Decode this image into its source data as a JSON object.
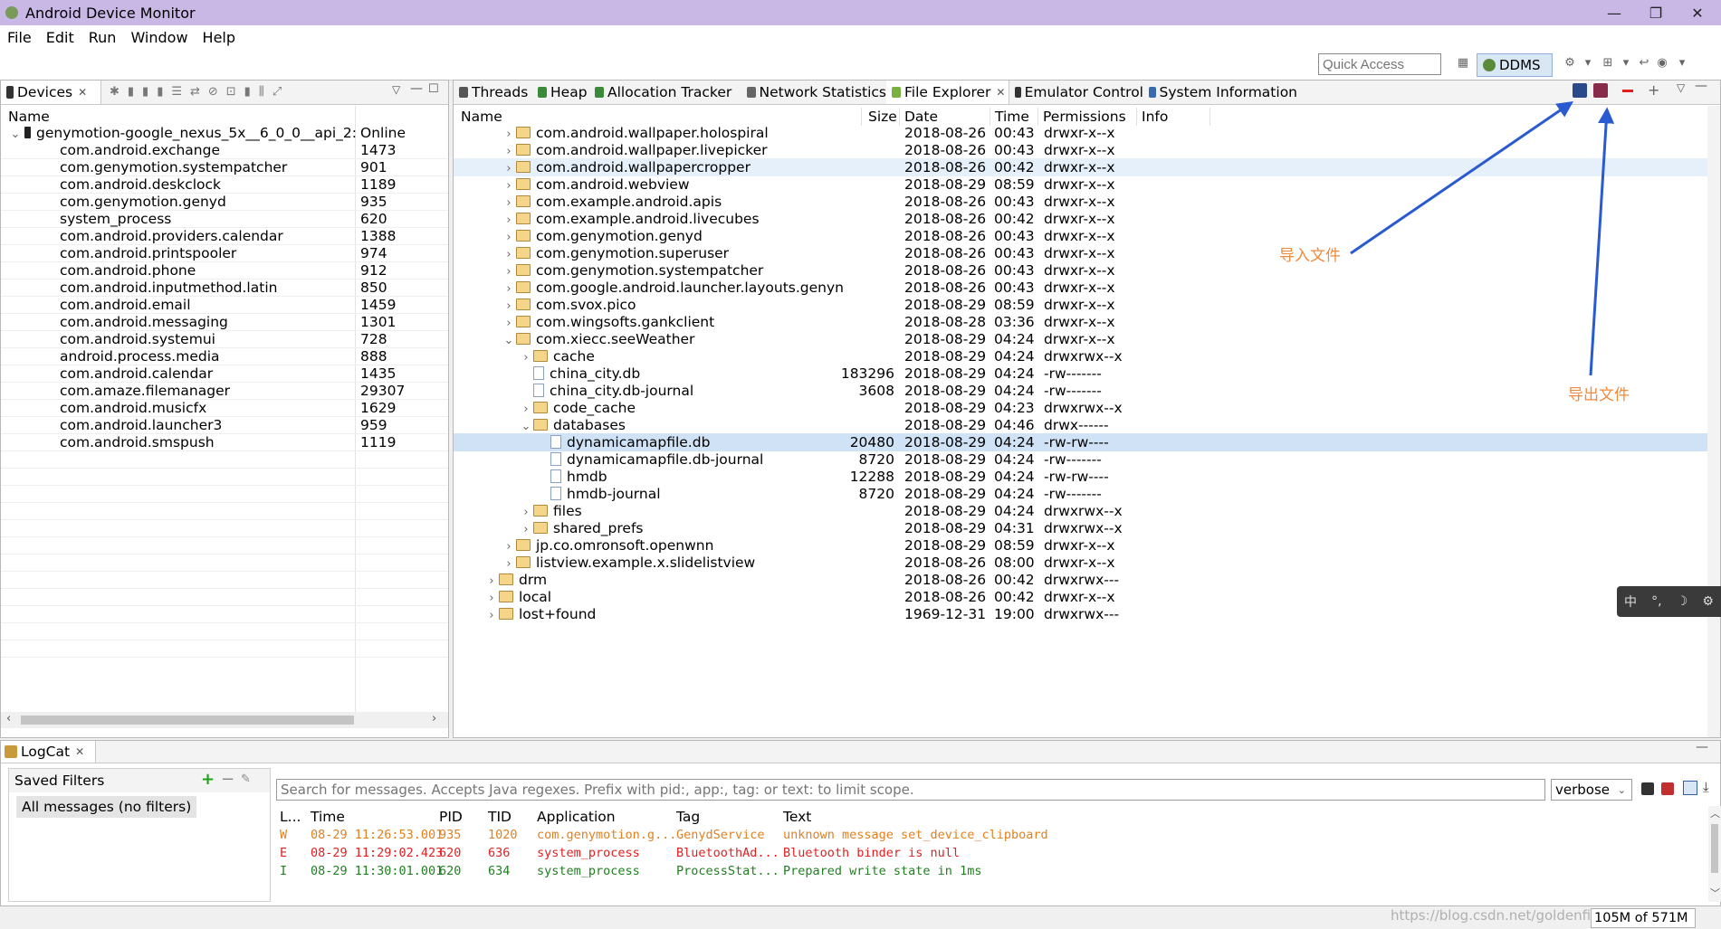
{
  "window": {
    "title": "Android Device Monitor",
    "controls": [
      "—",
      "❐",
      "✕"
    ]
  },
  "menu": [
    "File",
    "Edit",
    "Run",
    "Window",
    "Help"
  ],
  "toolbar": {
    "quick_access_placeholder": "Quick Access",
    "perspective": "DDMS"
  },
  "devices": {
    "tab": "Devices",
    "columns": [
      "Name",
      ""
    ],
    "device": {
      "name": "genymotion-google_nexus_5x__6_0_0__api_2:",
      "status": "Online"
    },
    "processes": [
      {
        "name": "com.android.exchange",
        "pid": "1473"
      },
      {
        "name": "com.genymotion.systempatcher",
        "pid": "901"
      },
      {
        "name": "com.android.deskclock",
        "pid": "1189"
      },
      {
        "name": "com.genymotion.genyd",
        "pid": "935"
      },
      {
        "name": "system_process",
        "pid": "620"
      },
      {
        "name": "com.android.providers.calendar",
        "pid": "1388"
      },
      {
        "name": "com.android.printspooler",
        "pid": "974"
      },
      {
        "name": "com.android.phone",
        "pid": "912"
      },
      {
        "name": "com.android.inputmethod.latin",
        "pid": "850"
      },
      {
        "name": "com.android.email",
        "pid": "1459"
      },
      {
        "name": "com.android.messaging",
        "pid": "1301"
      },
      {
        "name": "com.android.systemui",
        "pid": "728"
      },
      {
        "name": "android.process.media",
        "pid": "888"
      },
      {
        "name": "com.android.calendar",
        "pid": "1435"
      },
      {
        "name": "com.amaze.filemanager",
        "pid": "29307"
      },
      {
        "name": "com.android.musicfx",
        "pid": "1629"
      },
      {
        "name": "com.android.launcher3",
        "pid": "959"
      },
      {
        "name": "com.android.smspush",
        "pid": "1119"
      }
    ]
  },
  "tabs": [
    "Threads",
    "Heap",
    "Allocation Tracker",
    "Network Statistics",
    "File Explorer",
    "Emulator Control",
    "System Information"
  ],
  "file_explorer": {
    "columns": [
      "Name",
      "Size",
      "Date",
      "Time",
      "Permissions",
      "Info"
    ],
    "rows": [
      {
        "indent": 2,
        "type": "folder",
        "chev": "›",
        "name": "com.android.wallpaper.holospiral",
        "size": "",
        "date": "2018-08-26",
        "time": "00:43",
        "perm": "drwxr-x--x"
      },
      {
        "indent": 2,
        "type": "folder",
        "chev": "›",
        "name": "com.android.wallpaper.livepicker",
        "size": "",
        "date": "2018-08-26",
        "time": "00:43",
        "perm": "drwxr-x--x"
      },
      {
        "indent": 2,
        "type": "folder",
        "chev": "›",
        "name": "com.android.wallpapercropper",
        "size": "",
        "date": "2018-08-26",
        "time": "00:42",
        "perm": "drwxr-x--x",
        "hl": "light"
      },
      {
        "indent": 2,
        "type": "folder",
        "chev": "›",
        "name": "com.android.webview",
        "size": "",
        "date": "2018-08-29",
        "time": "08:59",
        "perm": "drwxr-x--x"
      },
      {
        "indent": 2,
        "type": "folder",
        "chev": "›",
        "name": "com.example.android.apis",
        "size": "",
        "date": "2018-08-26",
        "time": "00:43",
        "perm": "drwxr-x--x"
      },
      {
        "indent": 2,
        "type": "folder",
        "chev": "›",
        "name": "com.example.android.livecubes",
        "size": "",
        "date": "2018-08-26",
        "time": "00:42",
        "perm": "drwxr-x--x"
      },
      {
        "indent": 2,
        "type": "folder",
        "chev": "›",
        "name": "com.genymotion.genyd",
        "size": "",
        "date": "2018-08-26",
        "time": "00:43",
        "perm": "drwxr-x--x"
      },
      {
        "indent": 2,
        "type": "folder",
        "chev": "›",
        "name": "com.genymotion.superuser",
        "size": "",
        "date": "2018-08-26",
        "time": "00:43",
        "perm": "drwxr-x--x"
      },
      {
        "indent": 2,
        "type": "folder",
        "chev": "›",
        "name": "com.genymotion.systempatcher",
        "size": "",
        "date": "2018-08-26",
        "time": "00:43",
        "perm": "drwxr-x--x"
      },
      {
        "indent": 2,
        "type": "folder",
        "chev": "›",
        "name": "com.google.android.launcher.layouts.genyn",
        "size": "",
        "date": "2018-08-26",
        "time": "00:43",
        "perm": "drwxr-x--x"
      },
      {
        "indent": 2,
        "type": "folder",
        "chev": "›",
        "name": "com.svox.pico",
        "size": "",
        "date": "2018-08-29",
        "time": "08:59",
        "perm": "drwxr-x--x"
      },
      {
        "indent": 2,
        "type": "folder",
        "chev": "›",
        "name": "com.wingsofts.gankclient",
        "size": "",
        "date": "2018-08-28",
        "time": "03:36",
        "perm": "drwxr-x--x"
      },
      {
        "indent": 2,
        "type": "folder",
        "chev": "⌄",
        "name": "com.xiecc.seeWeather",
        "size": "",
        "date": "2018-08-29",
        "time": "04:24",
        "perm": "drwxr-x--x"
      },
      {
        "indent": 3,
        "type": "folder",
        "chev": "›",
        "name": "cache",
        "size": "",
        "date": "2018-08-29",
        "time": "04:24",
        "perm": "drwxrwx--x"
      },
      {
        "indent": 3,
        "type": "file",
        "chev": "",
        "name": "china_city.db",
        "size": "183296",
        "date": "2018-08-29",
        "time": "04:24",
        "perm": "-rw-------"
      },
      {
        "indent": 3,
        "type": "file",
        "chev": "",
        "name": "china_city.db-journal",
        "size": "3608",
        "date": "2018-08-29",
        "time": "04:24",
        "perm": "-rw-------"
      },
      {
        "indent": 3,
        "type": "folder",
        "chev": "›",
        "name": "code_cache",
        "size": "",
        "date": "2018-08-29",
        "time": "04:23",
        "perm": "drwxrwx--x"
      },
      {
        "indent": 3,
        "type": "folder",
        "chev": "⌄",
        "name": "databases",
        "size": "",
        "date": "2018-08-29",
        "time": "04:46",
        "perm": "drwx------"
      },
      {
        "indent": 4,
        "type": "file",
        "chev": "",
        "name": "dynamicamapfile.db",
        "size": "20480",
        "date": "2018-08-29",
        "time": "04:24",
        "perm": "-rw-rw----",
        "hl": "selected"
      },
      {
        "indent": 4,
        "type": "file",
        "chev": "",
        "name": "dynamicamapfile.db-journal",
        "size": "8720",
        "date": "2018-08-29",
        "time": "04:24",
        "perm": "-rw-------"
      },
      {
        "indent": 4,
        "type": "file",
        "chev": "",
        "name": "hmdb",
        "size": "12288",
        "date": "2018-08-29",
        "time": "04:24",
        "perm": "-rw-rw----"
      },
      {
        "indent": 4,
        "type": "file",
        "chev": "",
        "name": "hmdb-journal",
        "size": "8720",
        "date": "2018-08-29",
        "time": "04:24",
        "perm": "-rw-------"
      },
      {
        "indent": 3,
        "type": "folder",
        "chev": "›",
        "name": "files",
        "size": "",
        "date": "2018-08-29",
        "time": "04:24",
        "perm": "drwxrwx--x"
      },
      {
        "indent": 3,
        "type": "folder",
        "chev": "›",
        "name": "shared_prefs",
        "size": "",
        "date": "2018-08-29",
        "time": "04:31",
        "perm": "drwxrwx--x"
      },
      {
        "indent": 2,
        "type": "folder",
        "chev": "›",
        "name": "jp.co.omronsoft.openwnn",
        "size": "",
        "date": "2018-08-29",
        "time": "08:59",
        "perm": "drwxr-x--x"
      },
      {
        "indent": 2,
        "type": "folder",
        "chev": "›",
        "name": "listview.example.x.slidelistview",
        "size": "",
        "date": "2018-08-26",
        "time": "08:00",
        "perm": "drwxr-x--x"
      },
      {
        "indent": 1,
        "type": "folder",
        "chev": "›",
        "name": "drm",
        "size": "",
        "date": "2018-08-26",
        "time": "00:42",
        "perm": "drwxrwx---"
      },
      {
        "indent": 1,
        "type": "folder",
        "chev": "›",
        "name": "local",
        "size": "",
        "date": "2018-08-26",
        "time": "00:42",
        "perm": "drwxr-x--x"
      },
      {
        "indent": 1,
        "type": "folder",
        "chev": "›",
        "name": "lost+found",
        "size": "",
        "date": "1969-12-31",
        "time": "19:00",
        "perm": "drwxrwx---"
      }
    ]
  },
  "annotations": {
    "import": "导入文件",
    "export": "导出文件"
  },
  "logcat": {
    "tab": "LogCat",
    "saved_filters_label": "Saved Filters",
    "filter_item": "All messages (no filters)",
    "search_placeholder": "Search for messages. Accepts Java regexes. Prefix with pid:, app:, tag: or text: to limit scope.",
    "level": "verbose",
    "columns": [
      "L...",
      "Time",
      "PID",
      "TID",
      "Application",
      "Tag",
      "Text"
    ],
    "rows": [
      {
        "level": "W",
        "time": "08-29 11:26:53.001",
        "pid": "935",
        "tid": "1020",
        "app": "com.genymotion.g...",
        "tag": "GenydService",
        "text": "unknown message set_device_clipboard",
        "color": "#e08020"
      },
      {
        "level": "E",
        "time": "08-29 11:29:02.423",
        "pid": "620",
        "tid": "636",
        "app": "system_process",
        "tag": "BluetoothAd...",
        "text": "Bluetooth binder is null",
        "color": "#e02020"
      },
      {
        "level": "I",
        "time": "08-29 11:30:01.001",
        "pid": "620",
        "tid": "634",
        "app": "system_process",
        "tag": "ProcessStat...",
        "text": "Prepared write state in 1ms",
        "color": "#208020"
      }
    ]
  },
  "ime": [
    "中",
    "°,",
    "☽",
    "⚙"
  ],
  "status": {
    "memory": "105M of 571M",
    "watermark": "https://blog.csdn.net/goldenfish1919"
  }
}
